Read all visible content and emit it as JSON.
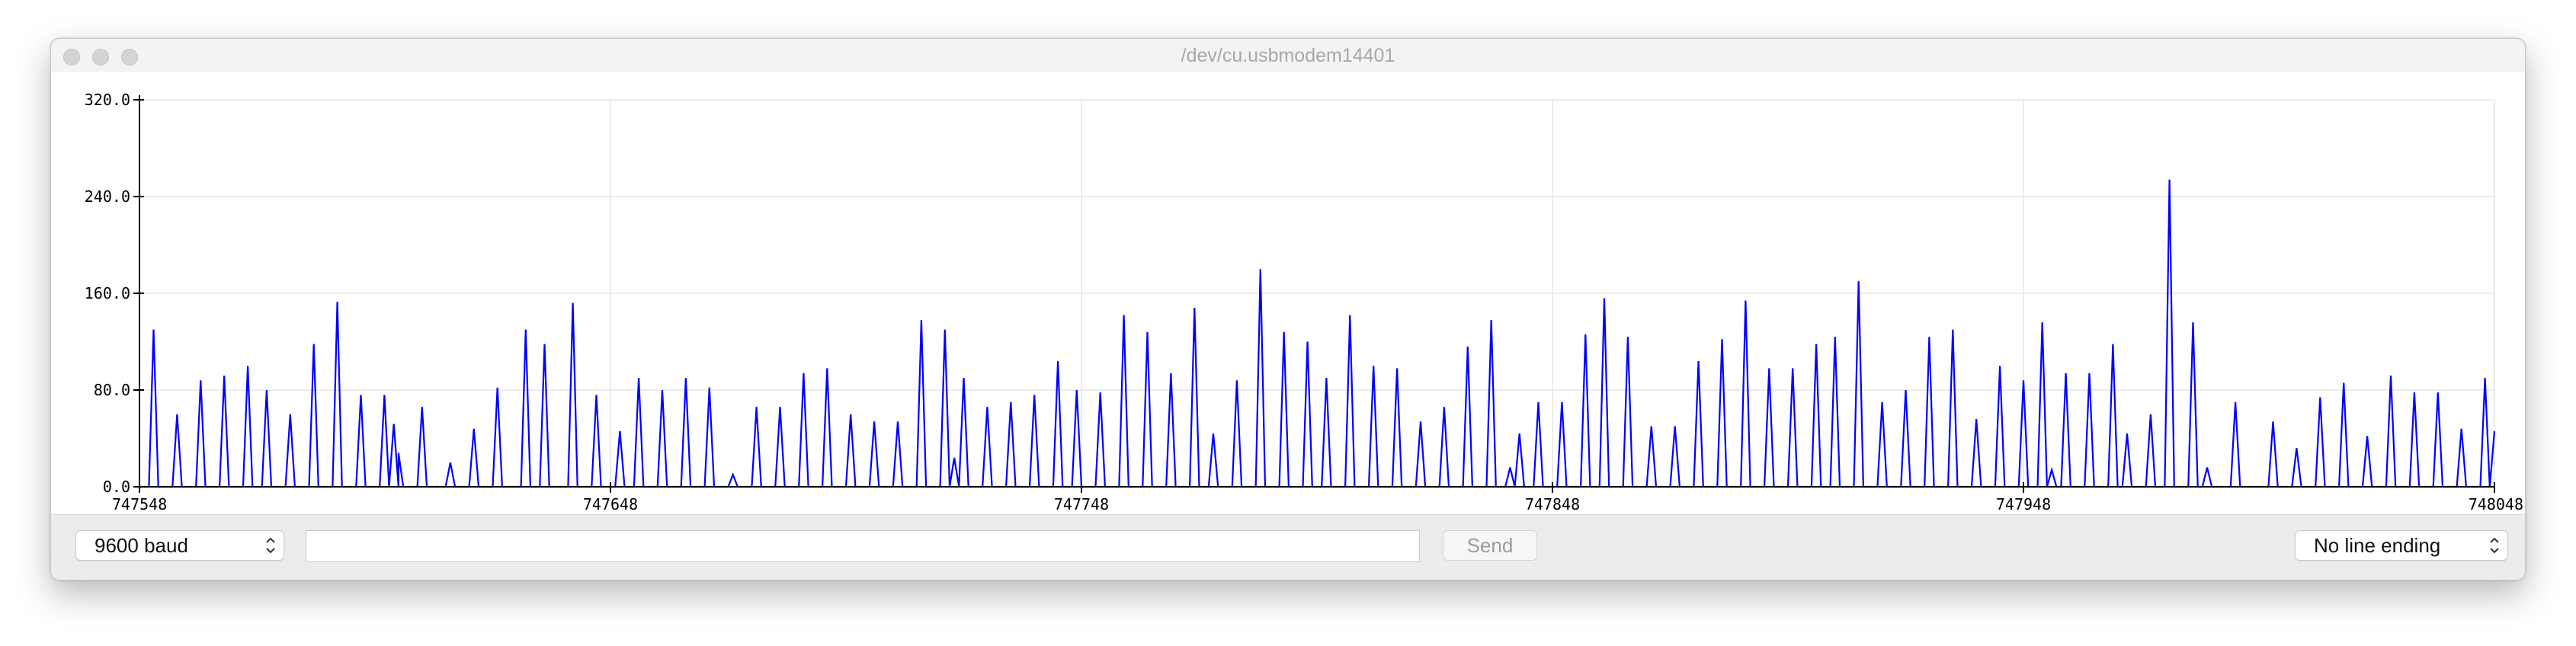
{
  "window": {
    "title": "/dev/cu.usbmodem14401"
  },
  "toolbar": {
    "baud_label": "9600 baud",
    "input_value": "",
    "send_label": "Send",
    "line_ending_label": "No line ending"
  },
  "colors": {
    "series": "#0000ff",
    "grid": "#e6e6e6",
    "axis": "#000000"
  },
  "chart_data": {
    "type": "line",
    "title": "",
    "xlabel": "",
    "ylabel": "",
    "xlim": [
      747548,
      748048
    ],
    "ylim": [
      0,
      320
    ],
    "grid": true,
    "legend": "none",
    "x_ticks": [
      "747548",
      "747648",
      "747748",
      "747848",
      "747948",
      "748048"
    ],
    "y_ticks": [
      "0.0",
      "80.0",
      "160.0",
      "240.0",
      "320.0"
    ],
    "series": [
      {
        "x_start": 747548,
        "step": 1,
        "peaks": [
          [
            747551,
            130
          ],
          [
            747556,
            60
          ],
          [
            747561,
            88
          ],
          [
            747566,
            92
          ],
          [
            747571,
            100
          ],
          [
            747575,
            80
          ],
          [
            747580,
            60
          ],
          [
            747585,
            118
          ],
          [
            747590,
            153
          ],
          [
            747595,
            76
          ],
          [
            747600,
            76
          ],
          [
            747602,
            52
          ],
          [
            747603,
            28
          ],
          [
            747608,
            66
          ],
          [
            747614,
            20
          ],
          [
            747619,
            48
          ],
          [
            747624,
            82
          ],
          [
            747630,
            130
          ],
          [
            747634,
            118
          ],
          [
            747640,
            152
          ],
          [
            747645,
            76
          ],
          [
            747650,
            46
          ],
          [
            747654,
            90
          ],
          [
            747659,
            80
          ],
          [
            747664,
            90
          ],
          [
            747669,
            82
          ],
          [
            747674,
            10
          ],
          [
            747679,
            66
          ],
          [
            747684,
            66
          ],
          [
            747689,
            94
          ],
          [
            747694,
            98
          ],
          [
            747699,
            60
          ],
          [
            747704,
            54
          ],
          [
            747709,
            54
          ],
          [
            747714,
            138
          ],
          [
            747719,
            130
          ],
          [
            747721,
            24
          ],
          [
            747723,
            90
          ],
          [
            747728,
            66
          ],
          [
            747733,
            70
          ],
          [
            747738,
            76
          ],
          [
            747743,
            104
          ],
          [
            747747,
            80
          ],
          [
            747752,
            78
          ],
          [
            747757,
            142
          ],
          [
            747762,
            128
          ],
          [
            747767,
            94
          ],
          [
            747772,
            148
          ],
          [
            747776,
            44
          ],
          [
            747781,
            88
          ],
          [
            747786,
            180
          ],
          [
            747791,
            128
          ],
          [
            747796,
            120
          ],
          [
            747800,
            90
          ],
          [
            747805,
            142
          ],
          [
            747810,
            100
          ],
          [
            747815,
            98
          ],
          [
            747820,
            54
          ],
          [
            747825,
            66
          ],
          [
            747830,
            116
          ],
          [
            747835,
            138
          ],
          [
            747839,
            16
          ],
          [
            747841,
            44
          ],
          [
            747845,
            70
          ],
          [
            747850,
            70
          ],
          [
            747855,
            126
          ],
          [
            747859,
            156
          ],
          [
            747864,
            124
          ],
          [
            747869,
            50
          ],
          [
            747874,
            50
          ],
          [
            747879,
            104
          ],
          [
            747884,
            122
          ],
          [
            747889,
            154
          ],
          [
            747894,
            98
          ],
          [
            747899,
            98
          ],
          [
            747904,
            118
          ],
          [
            747908,
            124
          ],
          [
            747913,
            170
          ],
          [
            747918,
            70
          ],
          [
            747923,
            80
          ],
          [
            747928,
            124
          ],
          [
            747933,
            130
          ],
          [
            747938,
            56
          ],
          [
            747943,
            100
          ],
          [
            747948,
            88
          ],
          [
            747952,
            136
          ],
          [
            747954,
            14
          ],
          [
            747957,
            94
          ],
          [
            747962,
            94
          ],
          [
            747967,
            118
          ],
          [
            747970,
            44
          ],
          [
            747975,
            60
          ],
          [
            747979,
            254
          ],
          [
            747984,
            136
          ],
          [
            747987,
            16
          ],
          [
            747993,
            70
          ],
          [
            748001,
            54
          ],
          [
            748006,
            32
          ],
          [
            748011,
            74
          ],
          [
            748016,
            86
          ],
          [
            748021,
            42
          ],
          [
            748026,
            92
          ],
          [
            748031,
            78
          ],
          [
            748036,
            78
          ],
          [
            748041,
            48
          ],
          [
            748046,
            90
          ],
          [
            748048,
            46
          ]
        ]
      }
    ]
  }
}
